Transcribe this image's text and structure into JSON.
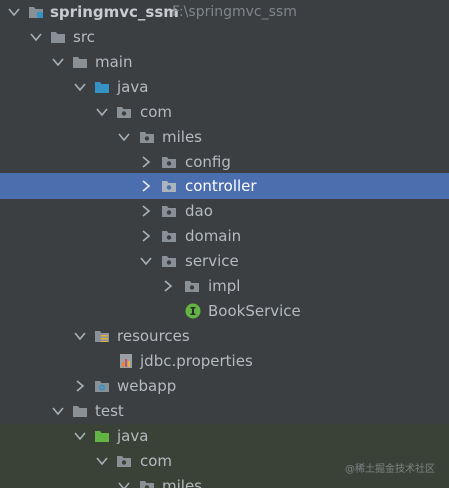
{
  "tree": {
    "project_name": "springmvc_ssm",
    "project_path": "F:\\springmvc_ssm",
    "src": "src",
    "main": "main",
    "java": "java",
    "com": "com",
    "miles": "miles",
    "config": "config",
    "controller": "controller",
    "dao": "dao",
    "domain": "domain",
    "service": "service",
    "impl": "impl",
    "book_service": "BookService",
    "resources": "resources",
    "jdbc_properties": "jdbc.properties",
    "webapp": "webapp",
    "test": "test",
    "test_java": "java",
    "test_com": "com",
    "test_miles": "miles"
  },
  "watermark": "@稀土掘金技术社区",
  "colors": {
    "background": "#3c3f41",
    "selection": "#4b6eaf",
    "test_area": "#3a4237",
    "folder": "#8a9196",
    "source_folder": "#3592c4",
    "test_source_folder": "#62b543",
    "interface_badge": "#62b543"
  }
}
